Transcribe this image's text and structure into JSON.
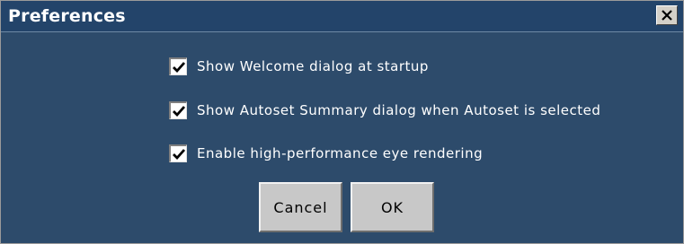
{
  "window": {
    "title": "Preferences",
    "close_icon": "close-x-icon"
  },
  "options": [
    {
      "label": "Show Welcome dialog at startup",
      "checked": true
    },
    {
      "label": "Show Autoset Summary dialog when Autoset is selected",
      "checked": true
    },
    {
      "label": "Enable high-performance eye rendering",
      "checked": true
    }
  ],
  "buttons": {
    "cancel_label": "Cancel",
    "ok_label": "OK"
  },
  "colors": {
    "background": "#2d4b6b",
    "titlebar": "#23446a",
    "text": "#ffffff",
    "button_face": "#c8c8c8"
  }
}
